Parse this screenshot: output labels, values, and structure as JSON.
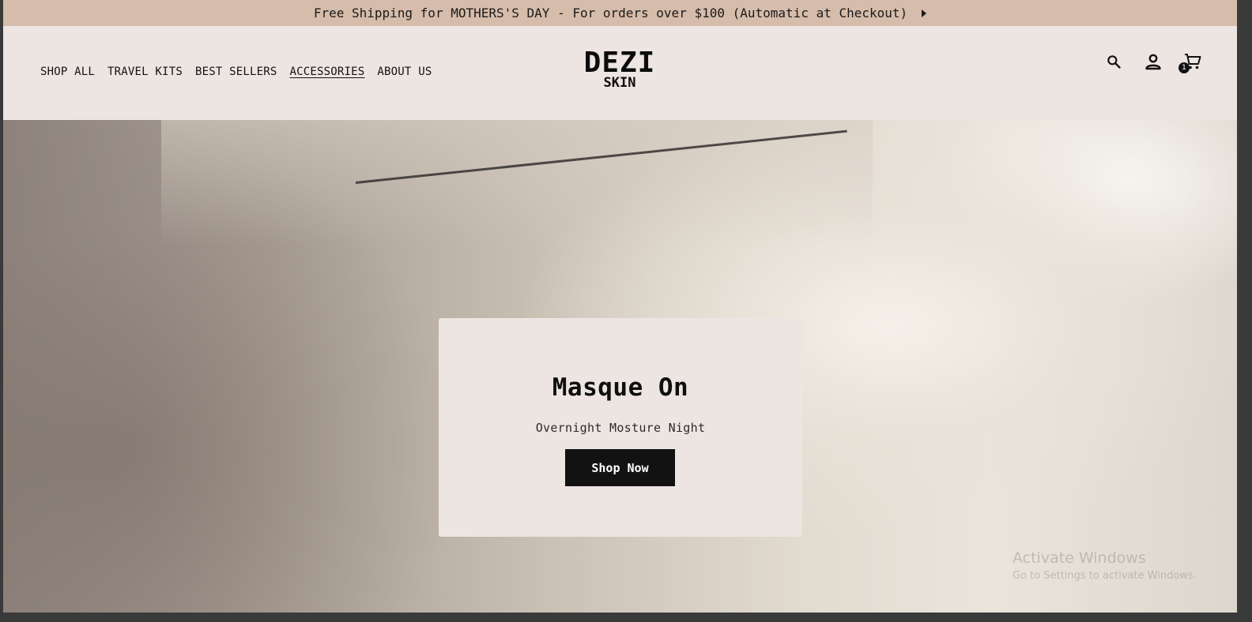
{
  "announcement": {
    "text": "Free Shipping for MOTHERS'S DAY - For orders over $100 (Automatic at Checkout)",
    "arrow_icon": "caret-right-icon"
  },
  "header": {
    "nav": [
      {
        "label": "SHOP ALL",
        "active": false
      },
      {
        "label": "TRAVEL KITS",
        "active": false
      },
      {
        "label": "BEST SELLERS",
        "active": false
      },
      {
        "label": "ACCESSORIES",
        "active": true
      },
      {
        "label": "ABOUT US",
        "active": false
      }
    ],
    "logo": {
      "line1": "DEZI",
      "line2": "SKIN"
    },
    "icons": {
      "search": "search-icon",
      "account": "account-icon",
      "cart": "cart-icon"
    },
    "cart_count": "1"
  },
  "hero": {
    "title": "Masque On",
    "subtitle": "Overnight Mosture Night",
    "button_label": "Shop Now"
  },
  "os_watermark": {
    "line1": "Activate Windows",
    "line2": "Go to Settings to activate Windows."
  },
  "colors": {
    "announcement_bg": "#d6bcaa",
    "header_bg": "#ede5e2",
    "button_bg": "#121212",
    "text": "#121212"
  }
}
